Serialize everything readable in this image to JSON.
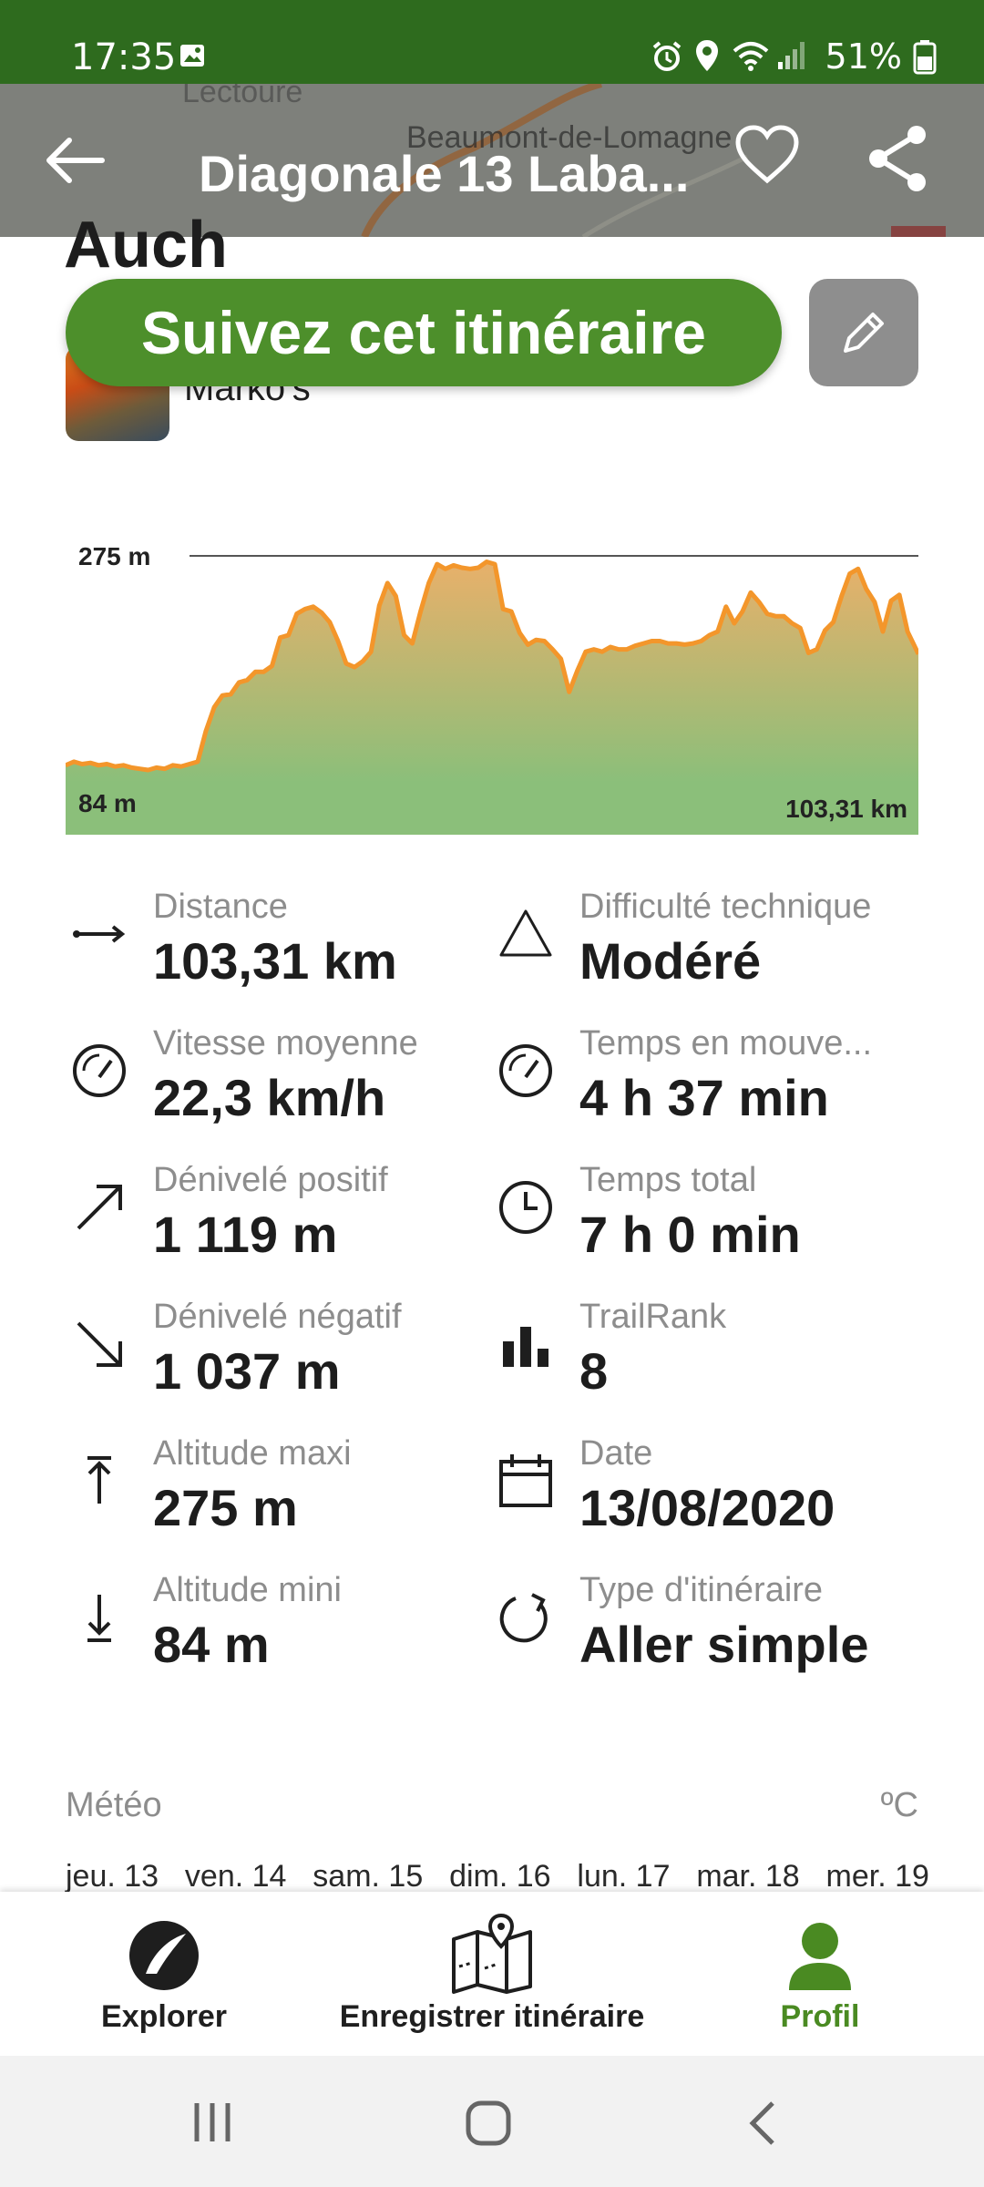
{
  "status_bar": {
    "time": "17:35",
    "battery": "51%"
  },
  "header": {
    "title": "Diagonale 13 Laba...",
    "map_labels": [
      "Lectoure",
      "Beaumont-de-Lomagne"
    ],
    "icons": [
      "back-arrow-icon",
      "heart-icon",
      "share-icon"
    ]
  },
  "route": {
    "title_partial": "Auch",
    "follow_button": "Suivez cet itinéraire",
    "author_partial": "Marko's"
  },
  "chart_data": {
    "type": "area",
    "title": "",
    "xlabel": "",
    "ylabel": "",
    "x_end_label": "103,31 km",
    "y_max_label": "275 m",
    "y_min_label": "84 m",
    "xlim": [
      0,
      103.31
    ],
    "ylim": [
      84,
      275
    ],
    "x": [
      0,
      1,
      2,
      3,
      4,
      5,
      6,
      7,
      8,
      9,
      10,
      11,
      12,
      13,
      14,
      15,
      16,
      17,
      18,
      19,
      20,
      21,
      22,
      23,
      24,
      25,
      26,
      27,
      28,
      29,
      30,
      31,
      32,
      33,
      34,
      35,
      36,
      37,
      38,
      39,
      40,
      41,
      42,
      43,
      44,
      45,
      46,
      47,
      48,
      49,
      50,
      51,
      52,
      53,
      54,
      55,
      56,
      57,
      58,
      59,
      60,
      61,
      62,
      63,
      64,
      65,
      66,
      67,
      68,
      69,
      70,
      71,
      72,
      73,
      74,
      75,
      76,
      77,
      78,
      79,
      80,
      81,
      82,
      83,
      84,
      85,
      86,
      87,
      88,
      89,
      90,
      91,
      92,
      93,
      94,
      95,
      96,
      97,
      98,
      99,
      100,
      101,
      102,
      103.31
    ],
    "values": [
      98,
      101,
      99,
      100,
      98,
      99,
      97,
      98,
      96,
      95,
      94,
      96,
      95,
      98,
      97,
      99,
      101,
      127,
      147,
      157,
      158,
      168,
      170,
      177,
      177,
      182,
      206,
      208,
      226,
      230,
      232,
      227,
      219,
      203,
      184,
      181,
      186,
      194,
      233,
      252,
      241,
      208,
      201,
      228,
      252,
      268,
      264,
      267,
      265,
      264,
      265,
      270,
      268,
      230,
      228,
      210,
      200,
      204,
      203,
      196,
      188,
      160,
      178,
      194,
      196,
      194,
      198,
      196,
      196,
      199,
      201,
      203,
      203,
      201,
      201,
      200,
      201,
      203,
      208,
      211,
      232,
      218,
      228,
      244,
      236,
      226,
      224,
      224,
      218,
      214,
      193,
      196,
      212,
      219,
      241,
      260,
      264,
      247,
      236,
      211,
      237,
      242,
      211,
      192
    ]
  },
  "stats": [
    {
      "label": "Distance",
      "value": "103,31 km",
      "icon": "horizontal-arrows-icon"
    },
    {
      "label": "Difficulté technique",
      "value": "Modéré",
      "icon": "triangle-icon"
    },
    {
      "label": "Vitesse moyenne",
      "value": "22,3 km/h",
      "icon": "speedometer-icon"
    },
    {
      "label": "Temps en mouve...",
      "value": "4 h 37 min",
      "icon": "speedometer-icon"
    },
    {
      "label": "Dénivelé positif",
      "value": "1 119 m",
      "icon": "arrow-up-right-icon"
    },
    {
      "label": "Temps total",
      "value": "7 h 0 min",
      "icon": "clock-icon"
    },
    {
      "label": "Dénivelé négatif",
      "value": "1 037 m",
      "icon": "arrow-down-right-icon"
    },
    {
      "label": "TrailRank",
      "value": "8",
      "icon": "bar-chart-icon"
    },
    {
      "label": "Altitude maxi",
      "value": "275 m",
      "icon": "altitude-max-icon"
    },
    {
      "label": "Date",
      "value": "13/08/2020",
      "icon": "calendar-icon"
    },
    {
      "label": "Altitude mini",
      "value": "84 m",
      "icon": "altitude-min-icon"
    },
    {
      "label": "Type d'itinéraire",
      "value": "Aller simple",
      "icon": "loop-arrow-icon"
    }
  ],
  "weather": {
    "title": "Météo",
    "unit": "ºC",
    "days": [
      "jeu. 13",
      "ven. 14",
      "sam. 15",
      "dim. 16",
      "lun. 17",
      "mar. 18",
      "mer. 19"
    ]
  },
  "bottom_nav": [
    {
      "label": "Explorer",
      "icon": "explore-icon",
      "active": false
    },
    {
      "label": "Enregistrer itinéraire",
      "icon": "map-pin-icon",
      "active": false
    },
    {
      "label": "Profil",
      "icon": "profile-icon",
      "active": true
    }
  ],
  "colors": {
    "brand_green": "#4d8f2b",
    "status_bar": "#2e6b1e",
    "elevation_line": "#f3962b",
    "elevation_fill_top": "#e8b06a",
    "elevation_fill_bottom": "#8bbf7a",
    "active_nav": "#4a8a22"
  }
}
